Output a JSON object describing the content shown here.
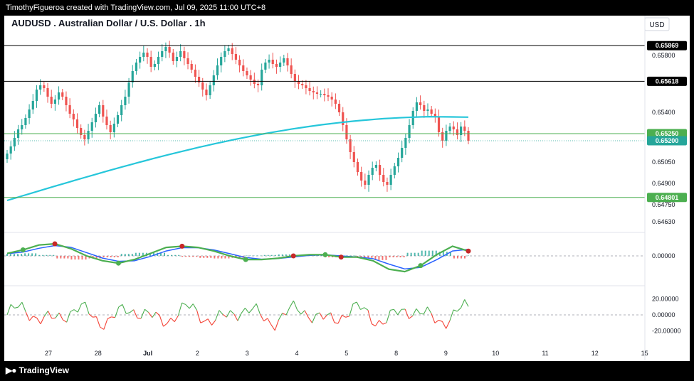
{
  "header": {
    "attribution": "TimothyFigueroa created with TradingView.com, Jul 09, 2025 11:00 UTC+8",
    "symbol_title": "AUDUSD . Australian Dollar / U.S. Dollar . 1h",
    "currency": "USD"
  },
  "footer": {
    "logo_text": "TradingView"
  },
  "colors": {
    "up": "#26a69a",
    "down": "#ef5350",
    "ma": "#26c6da",
    "macd_fast": "#4caf50",
    "macd_slow": "#2962ff",
    "macd_dark": "#b71c1c",
    "osc_up": "#4caf50",
    "osc_down": "#f44336",
    "hline": "#000000",
    "green_line": "#4caf50"
  },
  "chart_data": [
    {
      "type": "candlestick",
      "title": "AUDUSD . Australian Dollar / U.S. Dollar . 1h",
      "x_ticks": [
        "27",
        "28",
        "Jul",
        "2",
        "3",
        "4",
        "5",
        "8",
        "9",
        "10",
        "11",
        "12",
        "15"
      ],
      "y_ticks": [
        "0.65800",
        "0.65400",
        "0.65050",
        "0.64900",
        "0.64750",
        "0.64630"
      ],
      "ylim": [
        0.6458,
        0.6598
      ],
      "price_labels": [
        "0.65869",
        "0.65618",
        "0.65250",
        "0.65200",
        "0.64801"
      ],
      "horizontal_lines": [
        {
          "value": 0.65869,
          "style": "black"
        },
        {
          "value": 0.65618,
          "style": "black"
        },
        {
          "value": 0.6525,
          "style": "green"
        },
        {
          "value": 0.64801,
          "style": "green"
        }
      ],
      "last_price": 0.652,
      "close_series": [
        0.6511,
        0.6516,
        0.6522,
        0.6528,
        0.6531,
        0.6536,
        0.6542,
        0.6548,
        0.6556,
        0.6559,
        0.6557,
        0.6551,
        0.6546,
        0.6549,
        0.6554,
        0.6551,
        0.6545,
        0.6539,
        0.6535,
        0.6529,
        0.6524,
        0.6521,
        0.6527,
        0.6533,
        0.6539,
        0.6545,
        0.6537,
        0.6531,
        0.6526,
        0.6532,
        0.6538,
        0.6545,
        0.6551,
        0.6561,
        0.6569,
        0.6575,
        0.6579,
        0.6582,
        0.6579,
        0.6572,
        0.6574,
        0.6579,
        0.6583,
        0.6586,
        0.6582,
        0.6576,
        0.6579,
        0.6583,
        0.6578,
        0.6574,
        0.657,
        0.6565,
        0.6561,
        0.6556,
        0.6552,
        0.6559,
        0.6566,
        0.6573,
        0.6579,
        0.6583,
        0.6585,
        0.6581,
        0.6577,
        0.6573,
        0.6569,
        0.6566,
        0.6563,
        0.656,
        0.6559,
        0.657,
        0.6575,
        0.6577,
        0.6574,
        0.6572,
        0.6575,
        0.6578,
        0.6573,
        0.6567,
        0.6562,
        0.656,
        0.6559,
        0.6557,
        0.6555,
        0.6554,
        0.6553,
        0.6553,
        0.6552,
        0.6551,
        0.6549,
        0.6546,
        0.654,
        0.6531,
        0.6521,
        0.6512,
        0.6505,
        0.6498,
        0.6492,
        0.6489,
        0.6496,
        0.6501,
        0.6503,
        0.6496,
        0.6491,
        0.6489,
        0.6496,
        0.6502,
        0.6508,
        0.6515,
        0.6522,
        0.6531,
        0.6541,
        0.6547,
        0.6545,
        0.6541,
        0.6542,
        0.6539,
        0.6537,
        0.6526,
        0.652,
        0.6527,
        0.653,
        0.6528,
        0.6524,
        0.653,
        0.6527,
        0.652
      ],
      "overlay": {
        "type": "line",
        "values_start": 0.6478,
        "values_end": 0.6537
      }
    },
    {
      "type": "line",
      "y_ticks": [
        "0.00000"
      ],
      "series": [
        {
          "values": [
            0.2,
            0.5,
            0.9,
            1.0,
            0.6,
            0.0,
            -0.4,
            -0.6,
            -0.3,
            0.2,
            0.7,
            0.8,
            0.7,
            0.4,
            0.0,
            -0.3,
            -0.3,
            -0.2,
            0.0,
            0.1,
            0.1,
            -0.1,
            -0.1,
            -0.4,
            -1.1,
            -1.3,
            -0.8,
            0.1,
            0.8,
            0.4
          ]
        }
      ],
      "markers": [
        {
          "index": 1,
          "kind": "up"
        },
        {
          "index": 3,
          "kind": "down"
        },
        {
          "index": 7,
          "kind": "up"
        },
        {
          "index": 11,
          "kind": "down"
        },
        {
          "index": 15,
          "kind": "up"
        },
        {
          "index": 18,
          "kind": "down"
        },
        {
          "index": 20,
          "kind": "up"
        },
        {
          "index": 21,
          "kind": "down"
        },
        {
          "index": 26,
          "kind": "up"
        },
        {
          "index": 29,
          "kind": "down"
        }
      ]
    },
    {
      "type": "line",
      "y_ticks": [
        "20.00000",
        "0.00000",
        "-20.00000"
      ],
      "ylim": [
        -27,
        24
      ]
    }
  ]
}
